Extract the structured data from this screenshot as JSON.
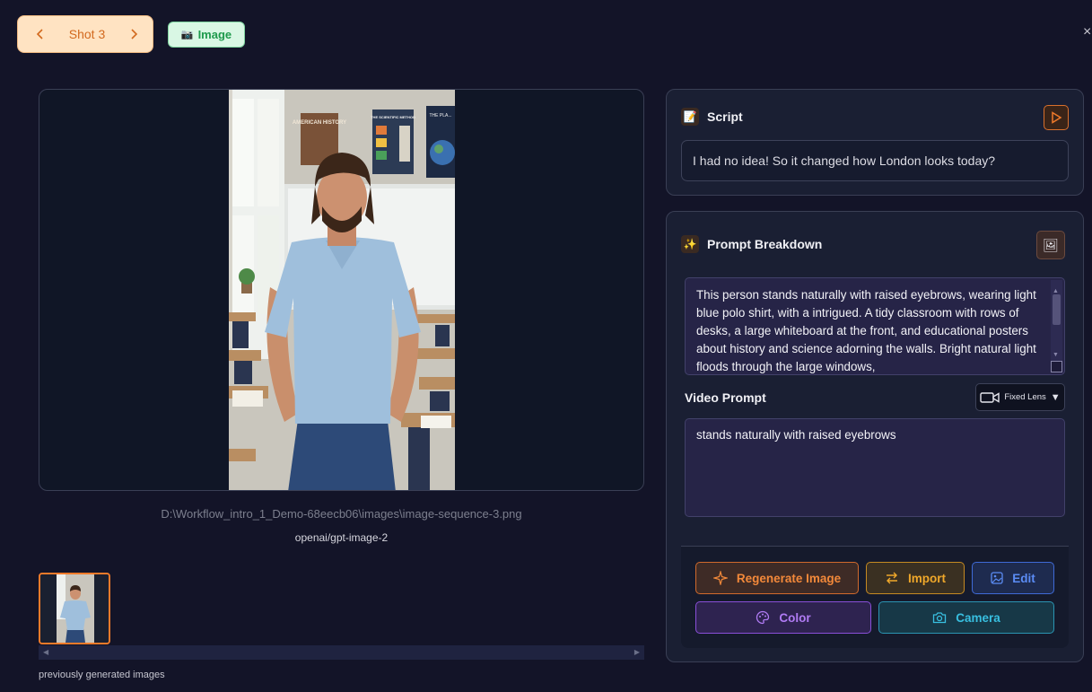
{
  "header": {
    "shot_label": "Shot 3",
    "type_badge": "Image",
    "close_glyph": "×"
  },
  "preview": {
    "file_path": "D:\\Workflow_intro_1_Demo-68eecb06\\images\\image-sequence-3.png",
    "model": "openai/gpt-image-2",
    "poster_1": "AMERICAN HISTORY",
    "poster_2": "THE SCIENTIFIC METHOD",
    "poster_3": "THE PLA..."
  },
  "history": {
    "label": "previously generated images"
  },
  "script": {
    "title": "Script",
    "text": "I had no idea! So it changed how London looks today?"
  },
  "prompt": {
    "title": "Prompt Breakdown",
    "text": "This person stands naturally with raised eyebrows, wearing light blue polo shirt, with a intrigued. A tidy classroom with rows of desks, a large whiteboard at the front, and educational posters about history and science adorning the walls. Bright natural light floods through the large windows,",
    "video_label": "Video Prompt",
    "lens": "Fixed Lens",
    "video_text": "stands naturally with raised eyebrows"
  },
  "actions": {
    "regenerate": "Regenerate Image",
    "import": "Import",
    "edit": "Edit",
    "color": "Color",
    "camera": "Camera"
  },
  "colors": {
    "background": "#131428",
    "accent_orange": "#f3893a",
    "accent_green": "#1e9a4c",
    "accent_blue": "#5b8cf5",
    "accent_purple": "#b07bf4",
    "accent_cyan": "#38bfe0"
  }
}
